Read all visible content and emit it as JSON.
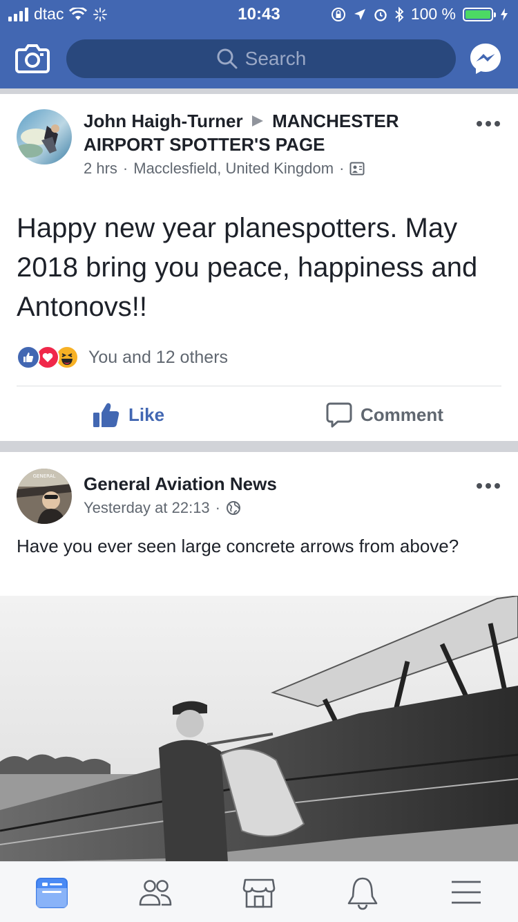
{
  "status_bar": {
    "carrier": "dtac",
    "time": "10:43",
    "battery": "100 %"
  },
  "header": {
    "search_placeholder": "Search"
  },
  "post1": {
    "author": "John Haigh-Turner",
    "target": "MANCHESTER AIRPORT SPOTTER'S PAGE",
    "time": "2 hrs",
    "location": "Macclesfield, United Kingdom",
    "text": "Happy new year planespotters. May 2018 bring you peace, happiness and Antonovs!!",
    "reactions_summary": "You and 12 others",
    "like_label": "Like",
    "comment_label": "Comment"
  },
  "post2": {
    "author": "General Aviation News",
    "time": "Yesterday at 22:13",
    "text": "Have you ever seen large concrete arrows from above?"
  },
  "colors": {
    "brand": "#4267b2",
    "search_bg": "#29487d",
    "like_blue": "#4267b2",
    "love_red": "#f0284a",
    "haha_yellow": "#f7b125"
  }
}
